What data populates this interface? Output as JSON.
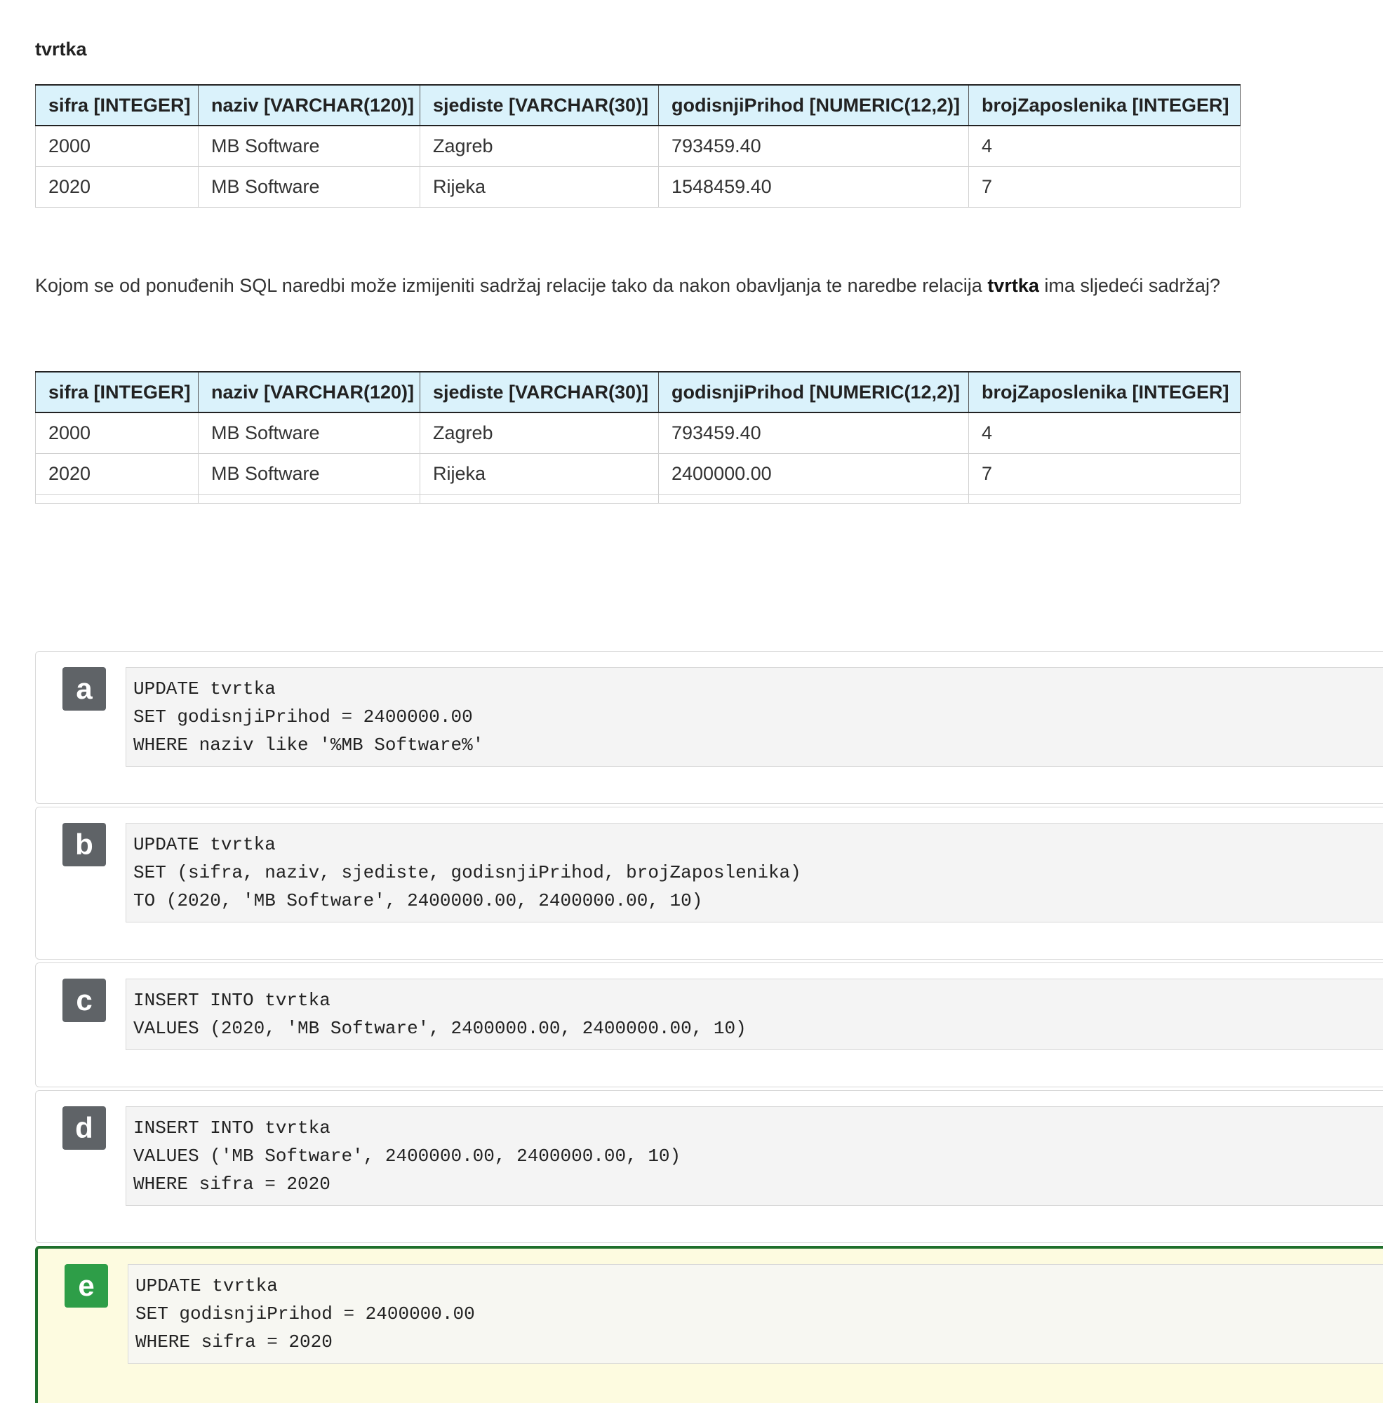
{
  "relation_name": "tvrtka",
  "columns": [
    "sifra [INTEGER]",
    "naziv [VARCHAR(120)]",
    "sjediste [VARCHAR(30)]",
    "godisnjiPrihod [NUMERIC(12,2)]",
    "brojZaposlenika [INTEGER]"
  ],
  "table_before": {
    "rows": [
      [
        "2000",
        "MB Software",
        "Zagreb",
        "793459.40",
        "4"
      ],
      [
        "2020",
        "MB Software",
        "Rijeka",
        "1548459.40",
        "7"
      ]
    ]
  },
  "question": {
    "before": "Kojom se od ponuđenih SQL naredbi može izmijeniti sadržaj relacije tako da nakon obavljanja te naredbe relacija ",
    "bold": "tvrtka",
    "after": " ima sljedeći sadržaj?"
  },
  "table_after": {
    "rows": [
      [
        "2000",
        "MB Software",
        "Zagreb",
        "793459.40",
        "4"
      ],
      [
        "2020",
        "MB Software",
        "Rijeka",
        "2400000.00",
        "7"
      ]
    ]
  },
  "options": [
    {
      "letter": "a",
      "lines": [
        "UPDATE tvrtka",
        "SET godisnjiPrihod = 2400000.00",
        "WHERE naziv like '%MB Software%'"
      ],
      "selected": false
    },
    {
      "letter": "b",
      "lines": [
        "UPDATE tvrtka",
        "SET (sifra, naziv, sjediste, godisnjiPrihod, brojZaposlenika)",
        "TO (2020, 'MB Software', 2400000.00, 2400000.00, 10)"
      ],
      "selected": false
    },
    {
      "letter": "c",
      "lines": [
        "INSERT INTO tvrtka",
        "VALUES (2020, 'MB Software', 2400000.00, 2400000.00, 10)"
      ],
      "selected": false
    },
    {
      "letter": "d",
      "lines": [
        "INSERT INTO tvrtka",
        "VALUES ('MB Software', 2400000.00, 2400000.00, 10)",
        "WHERE sifra = 2020"
      ],
      "selected": false
    },
    {
      "letter": "e",
      "lines": [
        "UPDATE tvrtka",
        "SET godisnjiPrihod = 2400000.00",
        "WHERE sifra = 2020"
      ],
      "selected": true
    }
  ],
  "colors": {
    "header_bg": "#daf2fb",
    "badge_default": "#5f6367",
    "badge_selected": "#2e9e48",
    "selected_border": "#1f6f2b",
    "selected_bg": "#fdfbe0"
  }
}
